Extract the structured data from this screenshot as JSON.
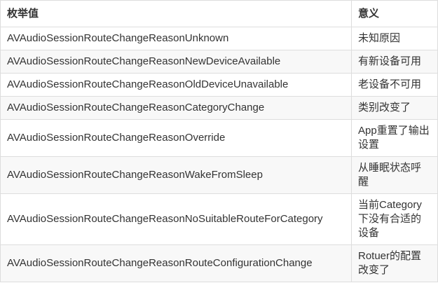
{
  "table": {
    "headers": [
      "枚举值",
      "意义"
    ],
    "rows": [
      {
        "name": "AVAudioSessionRouteChangeReasonUnknown",
        "meaning": "未知原因"
      },
      {
        "name": "AVAudioSessionRouteChangeReasonNewDeviceAvailable",
        "meaning": "有新设备可用"
      },
      {
        "name": "AVAudioSessionRouteChangeReasonOldDeviceUnavailable",
        "meaning": "老设备不可用"
      },
      {
        "name": "AVAudioSessionRouteChangeReasonCategoryChange",
        "meaning": "类别改变了"
      },
      {
        "name": "AVAudioSessionRouteChangeReasonOverride",
        "meaning": "App重置了输出设置"
      },
      {
        "name": "AVAudioSessionRouteChangeReasonWakeFromSleep",
        "meaning": "从睡眠状态呼醒"
      },
      {
        "name": "AVAudioSessionRouteChangeReasonNoSuitableRouteForCategory",
        "meaning": "当前Category下没有合适的设备"
      },
      {
        "name": "AVAudioSessionRouteChangeReasonRouteConfigurationChange",
        "meaning": "Rotuer的配置改变了"
      }
    ]
  }
}
